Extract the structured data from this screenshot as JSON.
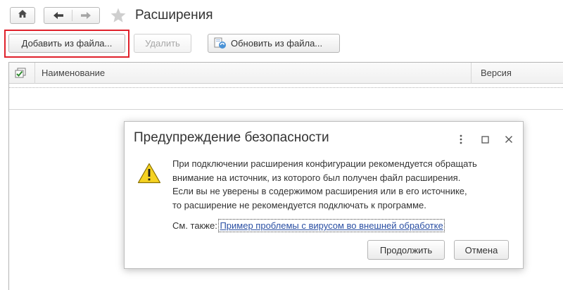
{
  "window": {
    "title": "Расширения"
  },
  "toolbar": {
    "add_from_file": "Добавить из файла...",
    "delete": "Удалить",
    "update_from_file": "Обновить из файла..."
  },
  "table": {
    "columns": [
      "Наименование",
      "Версия"
    ]
  },
  "dialog": {
    "title": "Предупреждение безопасности",
    "message_lines": [
      "При подключении расширения конфигурации рекомендуется обращать",
      "внимание на источник, из которого был получен файл расширения.",
      "Если вы не уверены в содержимом расширения или в его источнике,",
      "то расширение не рекомендуется подключать к программе."
    ],
    "see_also_label": "См. также:",
    "see_also_link": "Пример проблемы с вирусом во внешней обработке",
    "continue_label": "Продолжить",
    "cancel_label": "Отмена"
  },
  "icons": {
    "home": "home-icon",
    "back": "arrow-left-icon",
    "forward": "arrow-right-icon",
    "favorite": "star-icon",
    "update": "update-from-file-icon",
    "check_all": "check-all-icon",
    "warning": "warning-icon",
    "menu": "more-vertical-icon",
    "maximize": "maximize-icon",
    "close": "close-icon"
  },
  "colors": {
    "highlight": "#e0212b",
    "warning_fill": "#f5d221",
    "link": "#2a4fa3"
  }
}
